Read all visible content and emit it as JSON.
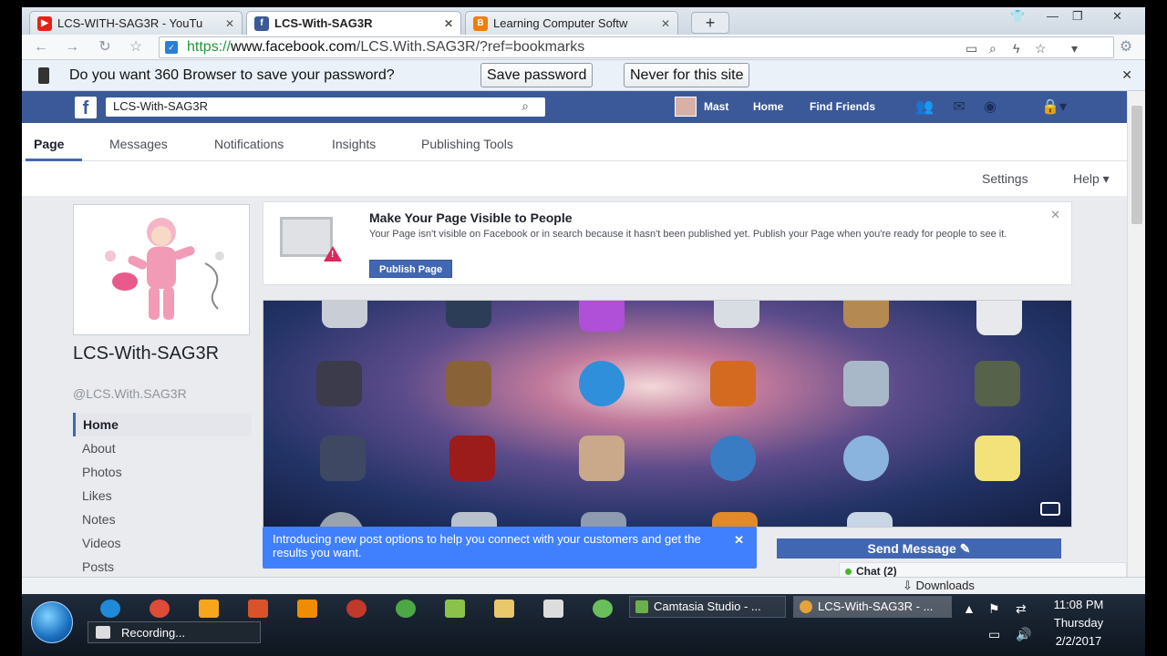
{
  "browser": {
    "tabs": [
      {
        "title": "LCS-WITH-SAG3R - YouTu",
        "favicon": "youtube-icon",
        "color": "#e62117"
      },
      {
        "title": "LCS-With-SAG3R",
        "favicon": "facebook-icon",
        "color": "#3b5998"
      },
      {
        "title": "Learning Computer Softw",
        "favicon": "blogger-icon",
        "color": "#f57d00"
      }
    ],
    "new_tab_symbol": "+",
    "url": {
      "protocol": "https://",
      "host": "www.facebook.com",
      "path": "/LCS.With.SAG3R/?ref=bookmarks"
    },
    "password_bar": {
      "message": "Do you want 360 Browser to save your password?",
      "save_label": "Save password",
      "never_label": "Never for this site"
    },
    "status": {
      "downloads_label": "Downloads"
    }
  },
  "facebook": {
    "search_value": "LCS-With-SAG3R",
    "user_name": "Mast",
    "nav_home": "Home",
    "nav_find_friends": "Find Friends",
    "page_tabs": [
      "Page",
      "Messages",
      "Notifications",
      "Insights",
      "Publishing Tools"
    ],
    "settings_label": "Settings",
    "help_label": "Help ▾",
    "page_name": "LCS-With-SAG3R",
    "page_handle": "@LCS.With.SAG3R",
    "side_nav": [
      "Home",
      "About",
      "Photos",
      "Likes",
      "Notes",
      "Videos",
      "Posts"
    ],
    "notice": {
      "title": "Make Your Page Visible to People",
      "body": "Your Page isn't visible on Facebook or in search because it hasn't been published yet. Publish your Page when you're ready for people to see it.",
      "button": "Publish Page"
    },
    "tooltip": "Introducing new post options to help you connect with your customers and get the results you want.",
    "send_message": "Send Message ✎",
    "chat_label": "Chat (2)",
    "brand_color": "#3b5998"
  },
  "taskbar": {
    "recording_label": "Recording...",
    "tasks": [
      {
        "title": "Camtasia Studio - ...",
        "icon": "camtasia-icon"
      },
      {
        "title": "LCS-With-SAG3R - ...",
        "icon": "browser-360-icon"
      }
    ],
    "clock": {
      "time": "11:08 PM",
      "day": "Thursday",
      "date": "2/2/2017"
    }
  }
}
